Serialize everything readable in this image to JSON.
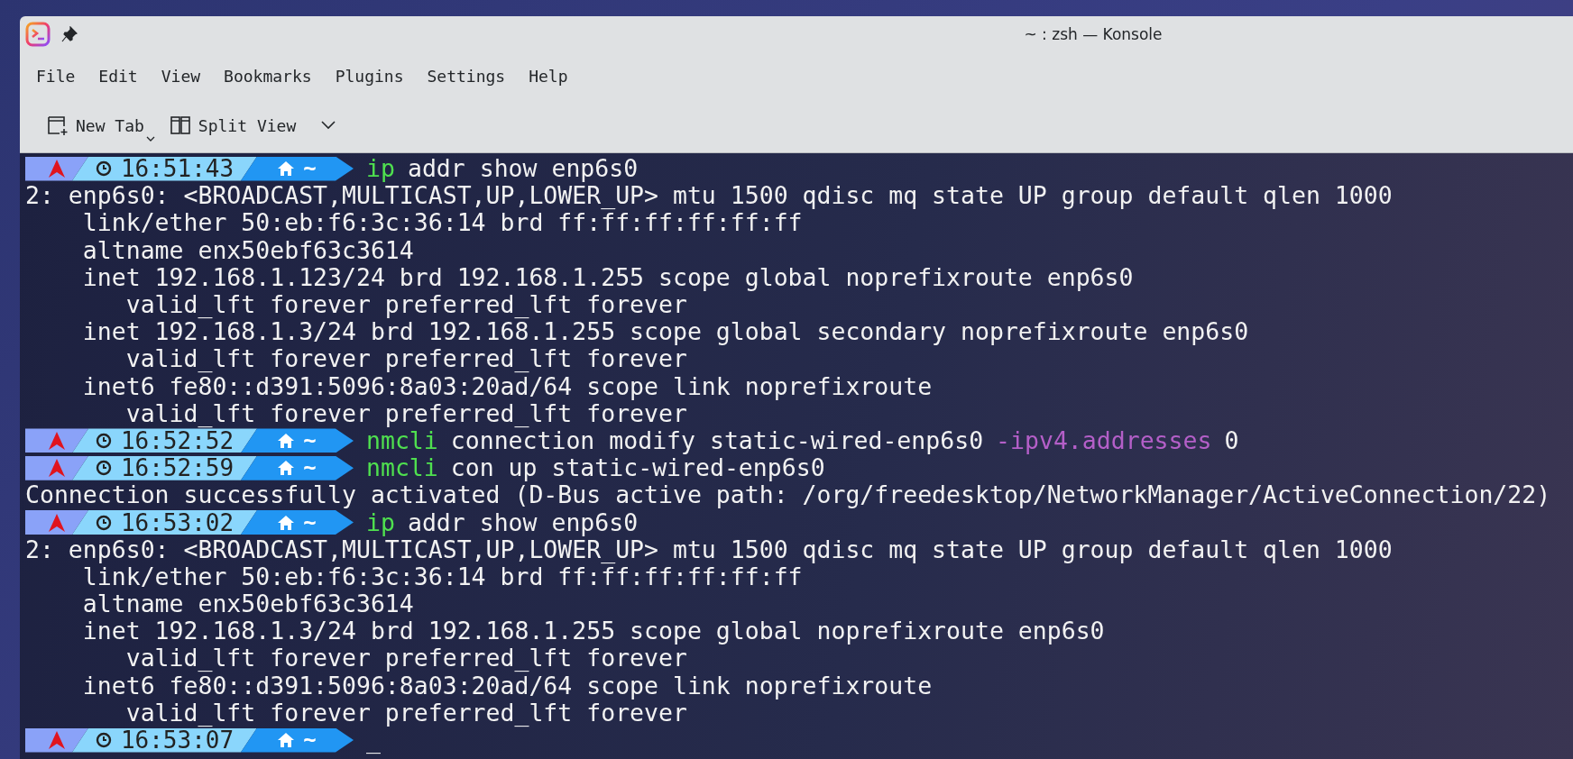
{
  "window": {
    "title": "~ : zsh — Konsole"
  },
  "menu": [
    "File",
    "Edit",
    "View",
    "Bookmarks",
    "Plugins",
    "Settings",
    "Help"
  ],
  "toolbar": [
    {
      "label": "New Tab",
      "kind": "new-tab"
    },
    {
      "label": "Split View",
      "kind": "split-view"
    }
  ],
  "terminal": {
    "lines": [
      {
        "kind": "prompt",
        "time": "16:51:43",
        "path": "~",
        "command": [
          {
            "kind": "program",
            "text": "ip"
          },
          {
            "kind": "argument",
            "text": "addr show enp6s0"
          }
        ]
      },
      {
        "kind": "output",
        "text": "2: enp6s0: <BROADCAST,MULTICAST,UP,LOWER_UP> mtu 1500 qdisc mq state UP group default qlen 1000"
      },
      {
        "kind": "output",
        "text": "    link/ether 50:eb:f6:3c:36:14 brd ff:ff:ff:ff:ff:ff"
      },
      {
        "kind": "output",
        "text": "    altname enx50ebf63c3614"
      },
      {
        "kind": "output",
        "text": "    inet 192.168.1.123/24 brd 192.168.1.255 scope global noprefixroute enp6s0"
      },
      {
        "kind": "output",
        "text": "       valid_lft forever preferred_lft forever"
      },
      {
        "kind": "output",
        "text": "    inet 192.168.1.3/24 brd 192.168.1.255 scope global secondary noprefixroute enp6s0"
      },
      {
        "kind": "output",
        "text": "       valid_lft forever preferred_lft forever"
      },
      {
        "kind": "output",
        "text": "    inet6 fe80::d391:5096:8a03:20ad/64 scope link noprefixroute"
      },
      {
        "kind": "output",
        "text": "       valid_lft forever preferred_lft forever"
      },
      {
        "kind": "prompt",
        "time": "16:52:52",
        "path": "~",
        "command": [
          {
            "kind": "program",
            "text": "nmcli"
          },
          {
            "kind": "argument",
            "text": "connection modify static-wired-enp6s0"
          },
          {
            "kind": "option",
            "text": "-ipv4.addresses"
          },
          {
            "kind": "argument",
            "text": "0"
          }
        ]
      },
      {
        "kind": "prompt",
        "time": "16:52:59",
        "path": "~",
        "command": [
          {
            "kind": "program",
            "text": "nmcli"
          },
          {
            "kind": "argument",
            "text": "con up static-wired-enp6s0"
          }
        ]
      },
      {
        "kind": "output",
        "text": "Connection successfully activated (D-Bus active path: /org/freedesktop/NetworkManager/ActiveConnection/22)"
      },
      {
        "kind": "prompt",
        "time": "16:53:02",
        "path": "~",
        "command": [
          {
            "kind": "program",
            "text": "ip"
          },
          {
            "kind": "argument",
            "text": "addr show enp6s0"
          }
        ]
      },
      {
        "kind": "output",
        "text": "2: enp6s0: <BROADCAST,MULTICAST,UP,LOWER_UP> mtu 1500 qdisc mq state UP group default qlen 1000"
      },
      {
        "kind": "output",
        "text": "    link/ether 50:eb:f6:3c:36:14 brd ff:ff:ff:ff:ff:ff"
      },
      {
        "kind": "output",
        "text": "    altname enx50ebf63c3614"
      },
      {
        "kind": "output",
        "text": "    inet 192.168.1.3/24 brd 192.168.1.255 scope global noprefixroute enp6s0"
      },
      {
        "kind": "output",
        "text": "       valid_lft forever preferred_lft forever"
      },
      {
        "kind": "output",
        "text": "    inet6 fe80::d391:5096:8a03:20ad/64 scope link noprefixroute"
      },
      {
        "kind": "output",
        "text": "       valid_lft forever preferred_lft forever"
      },
      {
        "kind": "prompt",
        "time": "16:53:07",
        "path": "~",
        "cursor": "_"
      }
    ]
  }
}
